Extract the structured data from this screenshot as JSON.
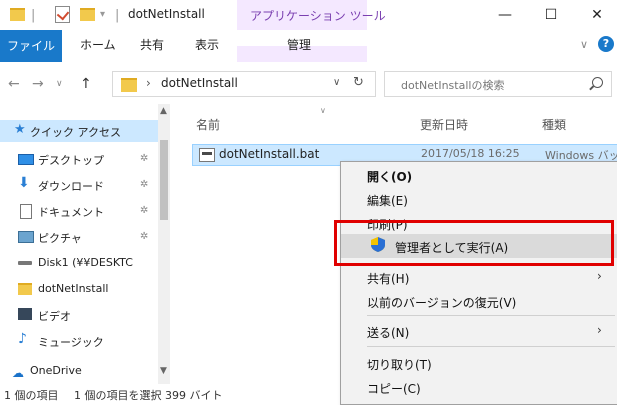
{
  "window": {
    "title": "dotNetInstall",
    "tool_tab": "アプリケーション ツール",
    "minimize": "—",
    "maximize": "☐",
    "close": "✕"
  },
  "ribbon": {
    "tabs": [
      "ファイル",
      "ホーム",
      "共有",
      "表示"
    ],
    "tool_subtab": "管理",
    "expand_glyph": "∨",
    "help_glyph": "?"
  },
  "address": {
    "back": "←",
    "forward": "→",
    "up": "↑",
    "path_sep": "›",
    "path": "dotNetInstall",
    "dropdown": "∨",
    "refresh": "↻",
    "search_placeholder": "dotNetInstallの検索"
  },
  "nav": {
    "items": [
      {
        "label": "クイック アクセス",
        "pinned": false
      },
      {
        "label": "デスクトップ",
        "pinned": true
      },
      {
        "label": "ダウンロード",
        "pinned": true
      },
      {
        "label": "ドキュメント",
        "pinned": true
      },
      {
        "label": "ピクチャ",
        "pinned": true
      },
      {
        "label": "Disk1 (¥¥DESKTC",
        "pinned": false
      },
      {
        "label": "dotNetInstall",
        "pinned": false
      },
      {
        "label": "ビデオ",
        "pinned": false
      },
      {
        "label": "ミュージック",
        "pinned": false
      },
      {
        "label": "OneDrive",
        "pinned": false
      }
    ],
    "pin_glyph": "📌"
  },
  "columns": {
    "name": "名前",
    "date": "更新日時",
    "type": "種類"
  },
  "files": [
    {
      "name": "dotNetInstall.bat",
      "date": "2017/05/18 16:25",
      "type": "Windows バッチ"
    }
  ],
  "status": {
    "count": "1 個の項目",
    "selected": "1 個の項目を選択 399 バイト"
  },
  "context_menu": {
    "items": [
      {
        "label": "開く(O)",
        "bold": true
      },
      {
        "label": "編集(E)"
      },
      {
        "label": "印刷(P)"
      },
      {
        "label": "管理者として実行(A)",
        "highlighted": true,
        "icon": "shield-icon"
      },
      {
        "label": "共有(H)",
        "submenu": true
      },
      {
        "label": "以前のバージョンの復元(V)"
      },
      {
        "label": "送る(N)",
        "submenu": true
      },
      {
        "label": "切り取り(T)"
      },
      {
        "label": "コピー(C)"
      }
    ],
    "submenu_glyph": "›"
  },
  "colors": {
    "accent": "#1979ca",
    "selection": "#cce8ff",
    "tool_tab": "#f4e8ff",
    "annotation_red": "#e00000"
  }
}
